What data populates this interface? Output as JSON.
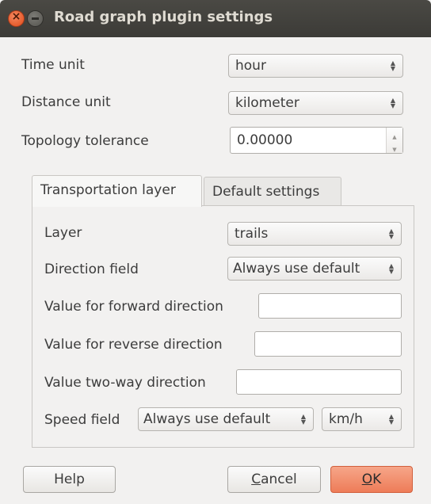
{
  "window": {
    "title": "Road graph plugin settings"
  },
  "general": {
    "time_unit": {
      "label": "Time unit",
      "value": "hour"
    },
    "distance_unit": {
      "label": "Distance unit",
      "value": "kilometer"
    },
    "topology_tolerance": {
      "label": "Topology tolerance",
      "value": "0.00000"
    }
  },
  "tabs": [
    {
      "label": "Transportation layer",
      "active": true
    },
    {
      "label": "Default settings",
      "active": false
    }
  ],
  "transport": {
    "layer": {
      "label": "Layer",
      "value": "trails"
    },
    "direction_field": {
      "label": "Direction field",
      "value": "Always use default"
    },
    "forward": {
      "label": "Value for forward direction",
      "value": ""
    },
    "reverse": {
      "label": "Value for reverse direction",
      "value": ""
    },
    "two_way": {
      "label": "Value two-way direction",
      "value": ""
    },
    "speed_field": {
      "label": "Speed field",
      "value": "Always use default",
      "unit": "km/h"
    }
  },
  "buttons": {
    "help": "Help",
    "cancel_mnemonic": "C",
    "cancel_rest": "ancel",
    "ok_mnemonic": "O",
    "ok_rest": "K"
  },
  "colors": {
    "titlebar": "#3c3b37",
    "ok_button": "#ee7c58",
    "close_button": "#e04b1a"
  }
}
